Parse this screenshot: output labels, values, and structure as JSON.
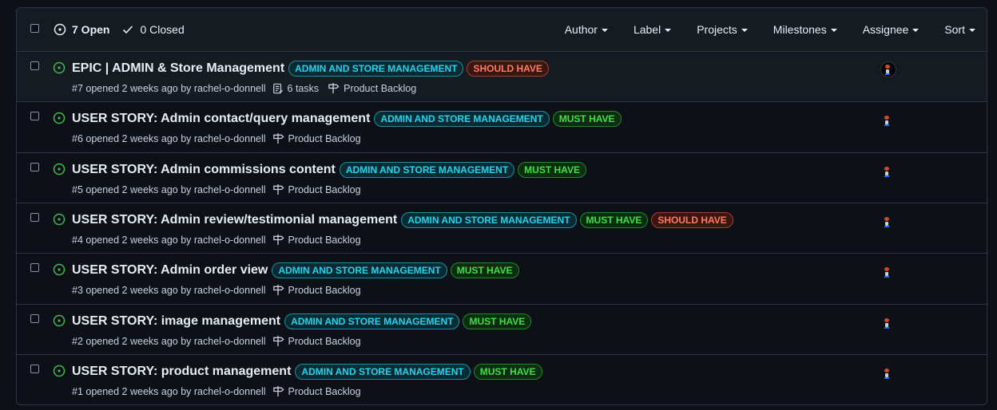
{
  "header": {
    "open_label": "7 Open",
    "closed_label": "0 Closed",
    "filters": [
      "Author",
      "Label",
      "Projects",
      "Milestones",
      "Assignee",
      "Sort"
    ]
  },
  "labels": {
    "admin": {
      "text": "ADMIN AND STORE MANAGEMENT",
      "color": "#22d3ee",
      "bg": "#062b33",
      "border": "#1b8fa3"
    },
    "must": {
      "text": "MUST HAVE",
      "color": "#3fdf44",
      "bg": "#0b2e10",
      "border": "#1f8a2a"
    },
    "should": {
      "text": "SHOULD HAVE",
      "color": "#ff7b61",
      "bg": "#3a1610",
      "border": "#a3402e"
    }
  },
  "colors": {
    "open_icon": "#3fb950"
  },
  "issues": [
    {
      "title": "EPIC | ADMIN & Store Management",
      "labels": [
        "ADMIN AND STORE MANAGEMENT",
        "SHOULD HAVE"
      ],
      "meta": "#7 opened 2 weeks ago by rachel-o-donnell",
      "tasks": "6 tasks",
      "project": "Product Backlog"
    },
    {
      "title": "USER STORY: Admin contact/query management",
      "labels": [
        "ADMIN AND STORE MANAGEMENT",
        "MUST HAVE"
      ],
      "meta": "#6 opened 2 weeks ago by rachel-o-donnell",
      "project": "Product Backlog"
    },
    {
      "title": "USER STORY: Admin commissions content",
      "labels": [
        "ADMIN AND STORE MANAGEMENT",
        "MUST HAVE"
      ],
      "meta": "#5 opened 2 weeks ago by rachel-o-donnell",
      "project": "Product Backlog"
    },
    {
      "title": "USER STORY: Admin review/testimonial management",
      "labels": [
        "ADMIN AND STORE MANAGEMENT",
        "MUST HAVE",
        "SHOULD HAVE"
      ],
      "meta": "#4 opened 2 weeks ago by rachel-o-donnell",
      "project": "Product Backlog"
    },
    {
      "title": "USER STORY: Admin order view",
      "labels": [
        "ADMIN AND STORE MANAGEMENT",
        "MUST HAVE"
      ],
      "meta": "#3 opened 2 weeks ago by rachel-o-donnell",
      "project": "Product Backlog"
    },
    {
      "title": "USER STORY: image management",
      "labels": [
        "ADMIN AND STORE MANAGEMENT",
        "MUST HAVE"
      ],
      "meta": "#2 opened 2 weeks ago by rachel-o-donnell",
      "project": "Product Backlog"
    },
    {
      "title": "USER STORY: product management",
      "labels": [
        "ADMIN AND STORE MANAGEMENT",
        "MUST HAVE"
      ],
      "meta": "#1 opened 2 weeks ago by rachel-o-donnell",
      "project": "Product Backlog"
    }
  ]
}
